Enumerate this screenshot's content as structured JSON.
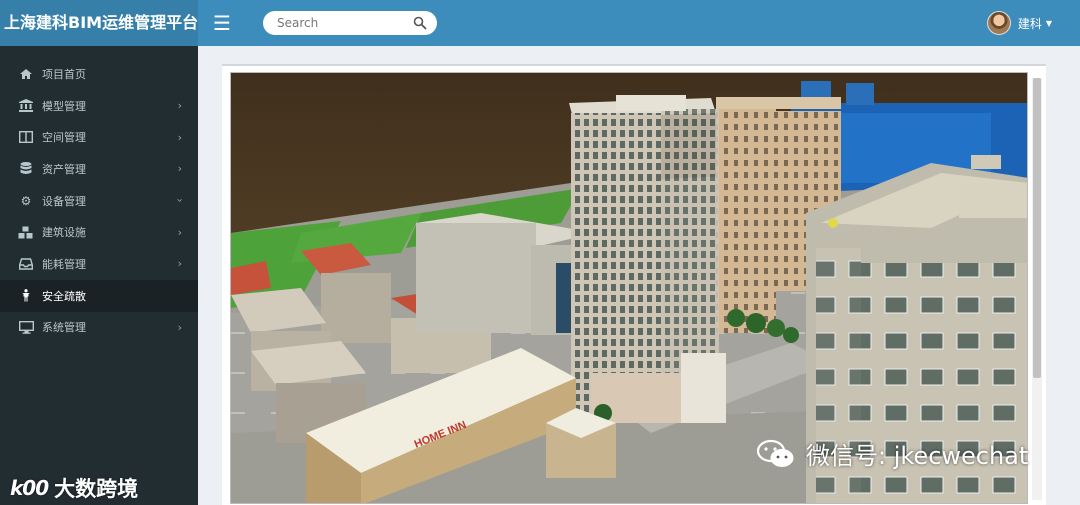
{
  "app": {
    "title": "上海建科BIM运维管理平台"
  },
  "search": {
    "placeholder": "Search"
  },
  "user": {
    "name": "建科"
  },
  "sidebar": {
    "items": [
      {
        "label": "项目首页",
        "icon": "home-icon",
        "has_submenu": false
      },
      {
        "label": "模型管理",
        "icon": "bank-icon",
        "has_submenu": true
      },
      {
        "label": "空间管理",
        "icon": "columns-icon",
        "has_submenu": true
      },
      {
        "label": "资产管理",
        "icon": "database-icon",
        "has_submenu": true
      },
      {
        "label": "设备管理",
        "icon": "cogs-icon",
        "has_submenu": true,
        "expanded": true
      },
      {
        "label": "建筑设施",
        "icon": "cubes-icon",
        "has_submenu": true
      },
      {
        "label": "能耗管理",
        "icon": "inbox-icon",
        "has_submenu": true
      },
      {
        "label": "安全疏散",
        "icon": "person-icon",
        "has_submenu": false,
        "active": true
      },
      {
        "label": "系统管理",
        "icon": "monitor-icon",
        "has_submenu": true
      }
    ]
  },
  "viewer": {
    "sign_text": "HOME INN"
  },
  "watermarks": {
    "left_mark": "k00",
    "left_text": "大数跨境",
    "right_text": "微信号: jkecwechat"
  },
  "colors": {
    "header": "#3c8dbc",
    "logo_bg": "#367fa9",
    "sidebar": "#222d32",
    "sidebar_active": "#1a2226"
  }
}
